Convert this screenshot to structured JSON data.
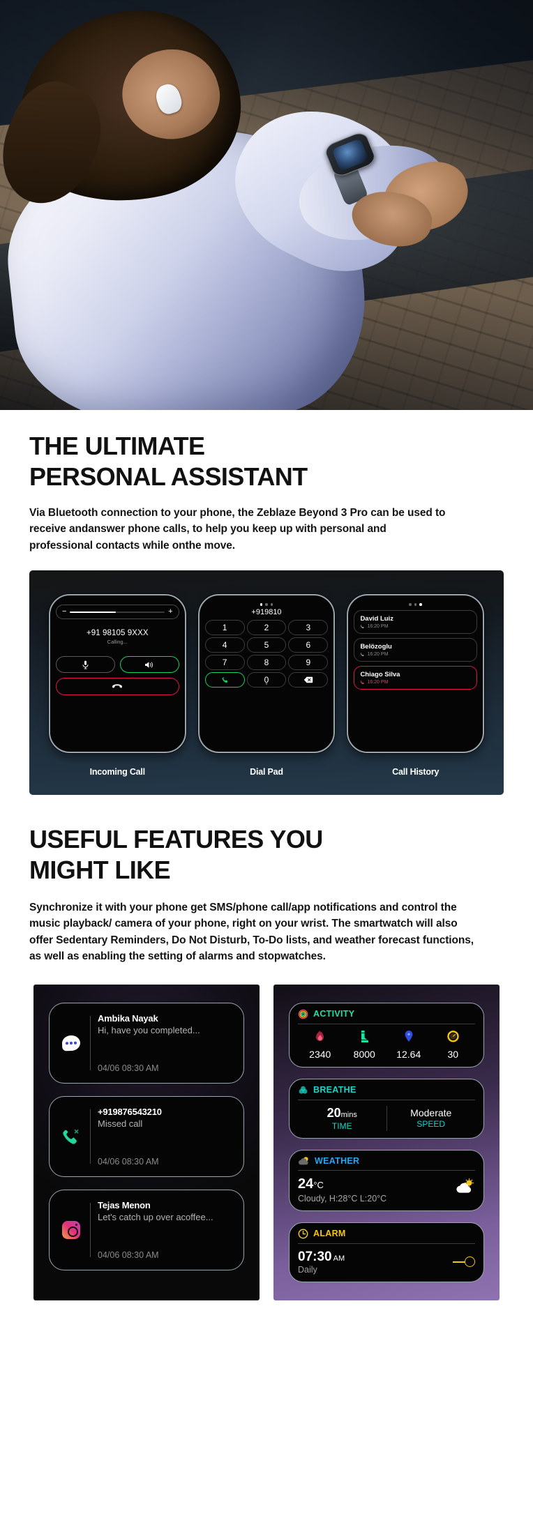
{
  "hero": {
    "alt": "Woman outdoors in white jacket checking her smartwatch"
  },
  "section1": {
    "headline_line1": "THE ULTIMATE",
    "headline_line2": "PERSONAL ASSISTANT",
    "paragraph": "Via Bluetooth connection to your phone, the Zeblaze Beyond 3 Pro can be used to receive andanswer phone calls, to help you keep up with personal and professional contacts while onthe move.",
    "panel": {
      "incoming_call": {
        "caption": "Incoming Call",
        "number": "+91 98105 9XXX",
        "status": "Calling...",
        "volume_minus": "−",
        "volume_plus": "+",
        "volume_fill_percent": 48,
        "mic_icon": "microphone-icon",
        "speaker_icon": "speaker-icon",
        "hangup_icon": "hangup-icon",
        "accent_green": "#13d463",
        "accent_red": "#e0134b"
      },
      "dial_pad": {
        "caption": "Dial Pad",
        "number": "+919810",
        "page_dots": 3,
        "active_dot_index": 0,
        "keys": [
          "1",
          "2",
          "3",
          "4",
          "5",
          "6",
          "7",
          "8",
          "9"
        ],
        "call_key_icon": "phone-icon",
        "zero_key": "0",
        "zero_key_sub": "+",
        "backspace_icon": "backspace-icon"
      },
      "call_history": {
        "caption": "Call History",
        "page_dots": 3,
        "active_dot_index": 2,
        "items": [
          {
            "name": "David Luiz",
            "time": "16:20 PM",
            "missed": false
          },
          {
            "name": "Belözoglu",
            "time": "16:20 PM",
            "missed": false
          },
          {
            "name": "Chiago Silva",
            "time": "16:20 PM",
            "missed": true
          }
        ]
      }
    }
  },
  "section2": {
    "headline_line1": "USEFUL FEATURES YOU",
    "headline_line2": "MIGHT LIKE",
    "paragraph": "Synchronize it with your phone get SMS/phone call/app notifications and control the music playback/ camera of your phone, right on your wrist. The smartwatch will also offer Sedentary Reminders, Do Not Disturb, To-Do lists, and weather forecast functions, as well as enabling the setting of alarms and stopwatches.",
    "notifications": [
      {
        "icon": "message-bubble-icon",
        "title": "Ambika Nayak",
        "subtitle": "Hi, have you completed...",
        "time": "04/06 08:30 AM"
      },
      {
        "icon": "missed-call-icon",
        "title": "+919876543210",
        "subtitle": "Missed call",
        "time": "04/06 08:30 AM"
      },
      {
        "icon": "instagram-icon",
        "title": "Tejas Menon",
        "subtitle": "Let's catch up over acoffee...",
        "time": "04/06 08:30 AM"
      }
    ],
    "widgets": {
      "activity": {
        "title": "ACTIVITY",
        "icon": "activity-rings-icon",
        "color": "#1ee0a0",
        "metrics": [
          {
            "icon": "flame-icon",
            "value": "2340",
            "color": "#e8506b"
          },
          {
            "icon": "boot-icon",
            "value": "8000",
            "color": "#1ee0a0"
          },
          {
            "icon": "location-pin-icon",
            "value": "12.64",
            "color": "#2f4fe0"
          },
          {
            "icon": "stopwatch-icon",
            "value": "30",
            "color": "#f5c518"
          }
        ]
      },
      "breathe": {
        "title": "BREATHE",
        "icon": "breathe-flower-icon",
        "color": "#19d4c8",
        "time_value": "20",
        "time_unit": "mins",
        "time_label": "TIME",
        "speed_value": "Moderate",
        "speed_label": "SPEED"
      },
      "weather": {
        "title": "WEATHER",
        "icon": "partly-cloudy-icon",
        "color": "#2aa5f0",
        "temperature": "24",
        "degree_unit": "°C",
        "description": "Cloudy, H:28°C  L:20°C",
        "condition_icon": "sun-behind-cloud-icon"
      },
      "alarm": {
        "title": "ALARM",
        "icon": "clock-icon",
        "color": "#f5c518",
        "time": "07:30",
        "meridiem": "AM",
        "repeat": "Daily",
        "toggle_state": "on"
      }
    }
  }
}
